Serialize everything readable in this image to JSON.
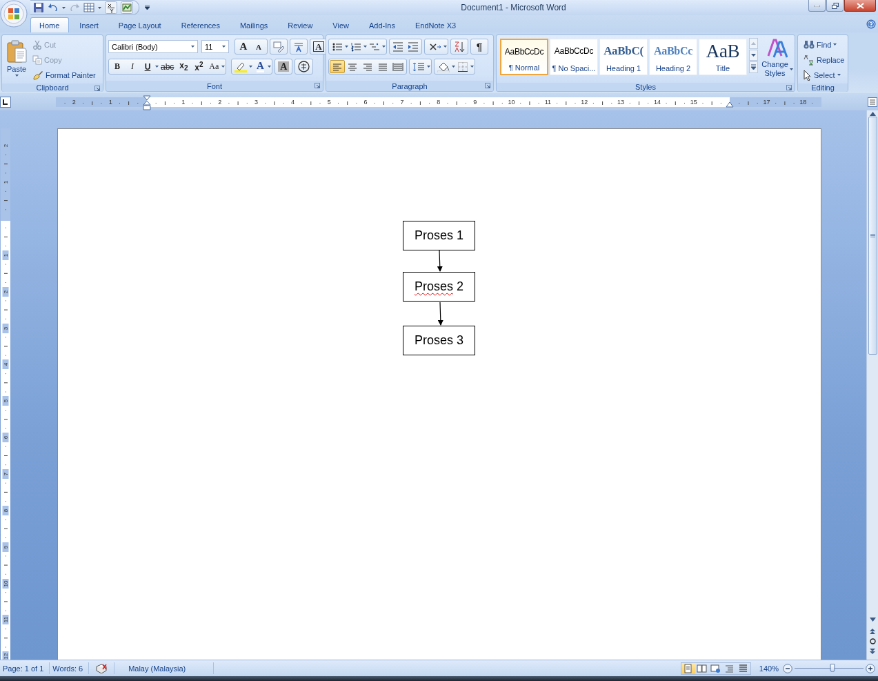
{
  "window": {
    "title": "Document1 - Microsoft Word"
  },
  "tabs": [
    {
      "label": "Home",
      "selected": true
    },
    {
      "label": "Insert",
      "selected": false
    },
    {
      "label": "Page Layout",
      "selected": false
    },
    {
      "label": "References",
      "selected": false
    },
    {
      "label": "Mailings",
      "selected": false
    },
    {
      "label": "Review",
      "selected": false
    },
    {
      "label": "View",
      "selected": false
    },
    {
      "label": "Add-Ins",
      "selected": false
    },
    {
      "label": "EndNote X3",
      "selected": false
    }
  ],
  "clipboard": {
    "label": "Clipboard",
    "paste": "Paste",
    "items": [
      {
        "kind": "cut",
        "label": "Cut",
        "disabled": true
      },
      {
        "kind": "copy",
        "label": "Copy",
        "disabled": true
      },
      {
        "kind": "painter",
        "label": "Format Painter",
        "disabled": false
      }
    ]
  },
  "font": {
    "label": "Font",
    "font_name": "Calibri (Body)",
    "font_size": "11",
    "grow": "A",
    "shrink": "A",
    "border_char": "A",
    "format_buttons": [
      "B",
      "I",
      "U",
      "abc",
      "x$_{2}$",
      "x$^{2}$",
      "Aa"
    ],
    "font_color": "A",
    "shading": "A"
  },
  "paragraph": {
    "label": "Paragraph",
    "show_marks": "¶",
    "alignments": [
      {
        "kind": "left",
        "selected": true
      },
      {
        "kind": "center",
        "selected": false
      },
      {
        "kind": "right",
        "selected": false
      },
      {
        "kind": "justify",
        "selected": false
      },
      {
        "kind": "distributed",
        "selected": false
      }
    ]
  },
  "styles": {
    "label": "Styles",
    "change_styles": "Change Styles",
    "items": [
      {
        "kind": "normal",
        "preview": "AaBbCcDc",
        "name": "¶ Normal",
        "selected": true
      },
      {
        "kind": "nospacing",
        "preview": "AaBbCcDc",
        "name": "¶ No Spaci...",
        "selected": false
      },
      {
        "kind": "heading1",
        "preview": "AaBbC(",
        "name": "Heading 1",
        "selected": false
      },
      {
        "kind": "heading2",
        "preview": "AaBbCc",
        "name": "Heading 2",
        "selected": false
      },
      {
        "kind": "title",
        "preview": "AaB",
        "name": "Title",
        "selected": false
      }
    ]
  },
  "editing": {
    "label": "Editing",
    "items": [
      {
        "kind": "find",
        "label": "Find"
      },
      {
        "kind": "replace",
        "label": "Replace"
      },
      {
        "kind": "select",
        "label": "Select"
      }
    ]
  },
  "ruler": {
    "horizontal": [
      "2",
      "1",
      "1",
      "2",
      "3",
      "4",
      "5",
      "6",
      "7",
      "8",
      "9",
      "10",
      "11",
      "12",
      "13",
      "14",
      "15",
      "17",
      "18"
    ],
    "vertical": [
      "2",
      "1",
      "1",
      "2",
      "3",
      "4",
      "5",
      "6",
      "7",
      "8",
      "9",
      "10",
      "11",
      "12"
    ]
  },
  "document": {
    "boxes": [
      {
        "text": "Proses 1",
        "misspelled": false
      },
      {
        "text": "Proses 2",
        "misspelled": true
      },
      {
        "text": "Proses 3",
        "misspelled": false
      }
    ]
  },
  "status_bar": {
    "page": "Page: 1 of 1",
    "words": "Words: 6",
    "language": "Malay (Malaysia)",
    "zoom": "140%",
    "zoom_slider": {
      "level": 0.55
    },
    "views": [
      {
        "kind": "print",
        "selected": true
      },
      {
        "kind": "reading",
        "selected": false
      },
      {
        "kind": "web",
        "selected": false
      },
      {
        "kind": "outline",
        "selected": false
      },
      {
        "kind": "draft",
        "selected": false
      }
    ]
  }
}
